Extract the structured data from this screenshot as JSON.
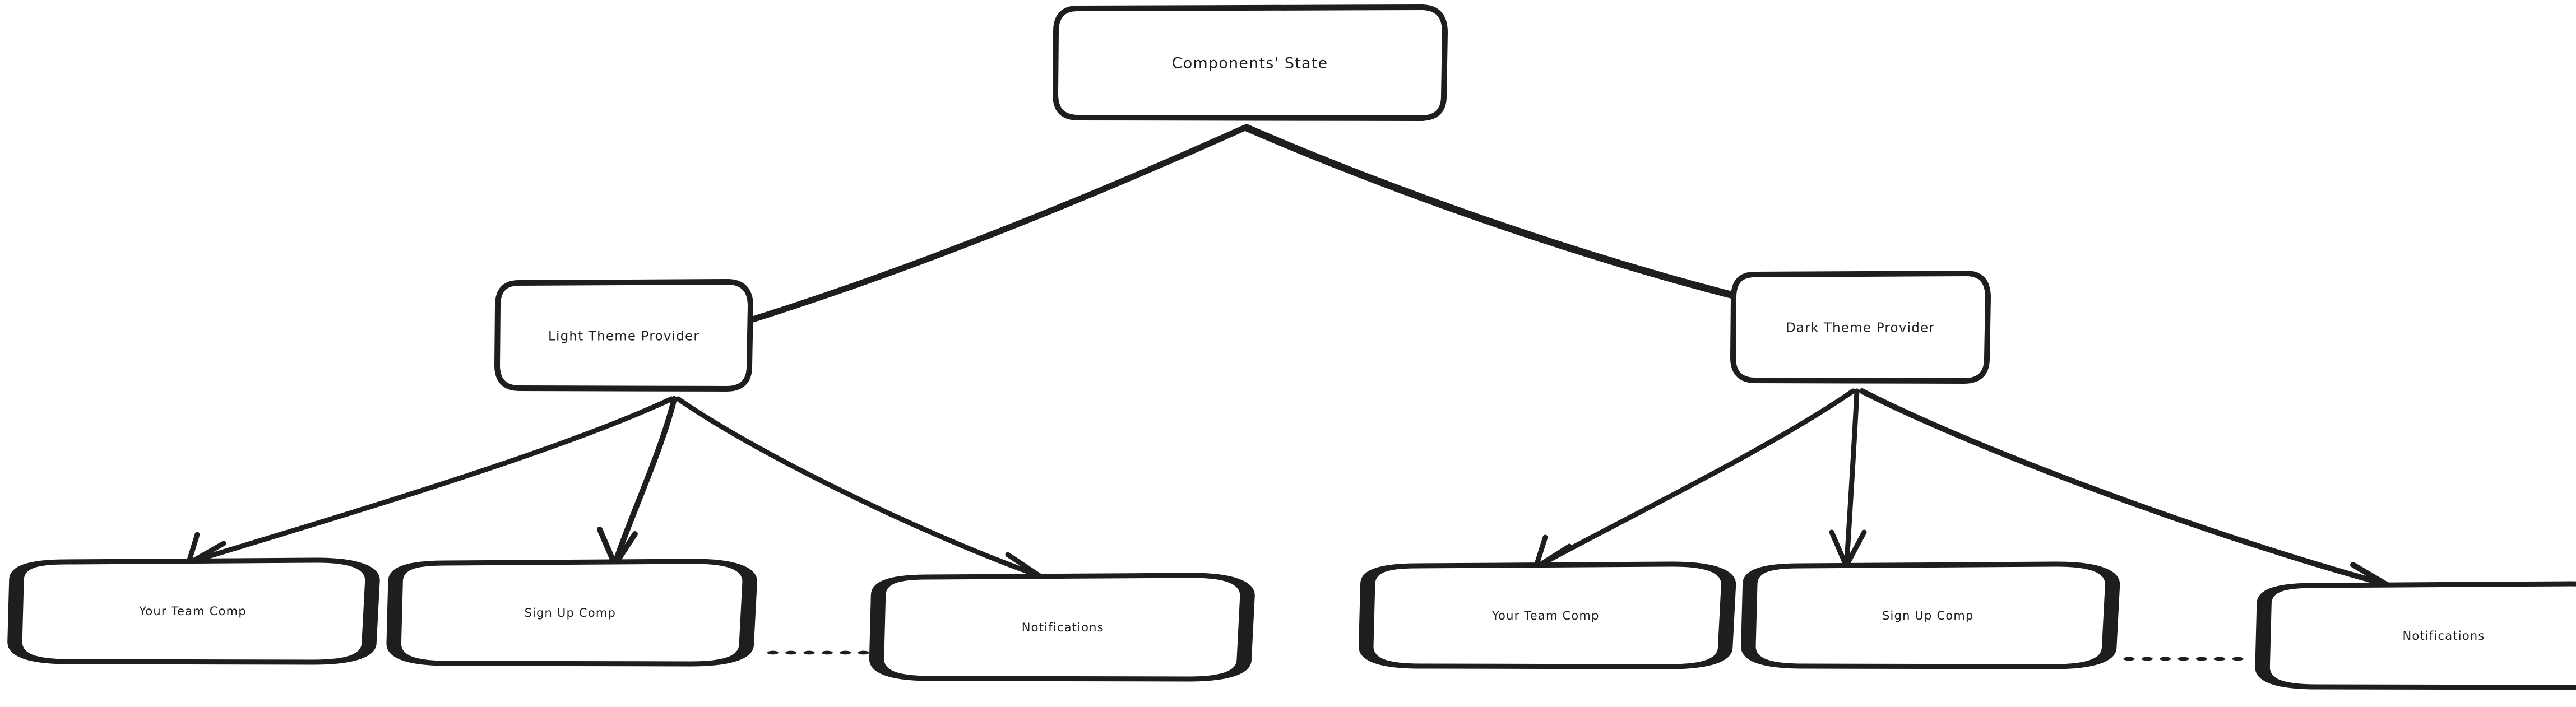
{
  "diagram": {
    "title": "Components' State",
    "style": {
      "ink": "#1e1e1e",
      "background": "#ffffff",
      "node_fill": "#ffffff"
    },
    "root": {
      "id": "components-state",
      "label": "Components' State"
    },
    "providers": [
      {
        "id": "light-theme-provider",
        "label": "Light Theme Provider",
        "children": [
          {
            "id": "light-your-team-comp",
            "label": "Your Team Comp"
          },
          {
            "id": "light-sign-up-comp",
            "label": "Sign Up Comp"
          },
          {
            "id": "light-notifications",
            "label": "Notifications"
          }
        ],
        "ellipsis": "......."
      },
      {
        "id": "dark-theme-provider",
        "label": "Dark Theme Provider",
        "children": [
          {
            "id": "dark-your-team-comp",
            "label": "Your Team Comp"
          },
          {
            "id": "dark-sign-up-comp",
            "label": "Sign Up Comp"
          },
          {
            "id": "dark-notifications",
            "label": "Notifications"
          }
        ],
        "ellipsis": "......."
      }
    ],
    "edges": [
      {
        "from": "components-state",
        "to": "light-theme-provider"
      },
      {
        "from": "components-state",
        "to": "dark-theme-provider"
      },
      {
        "from": "light-theme-provider",
        "to": "light-your-team-comp"
      },
      {
        "from": "light-theme-provider",
        "to": "light-sign-up-comp"
      },
      {
        "from": "light-theme-provider",
        "to": "light-notifications"
      },
      {
        "from": "dark-theme-provider",
        "to": "dark-your-team-comp"
      },
      {
        "from": "dark-theme-provider",
        "to": "dark-sign-up-comp"
      },
      {
        "from": "dark-theme-provider",
        "to": "dark-notifications"
      }
    ]
  }
}
